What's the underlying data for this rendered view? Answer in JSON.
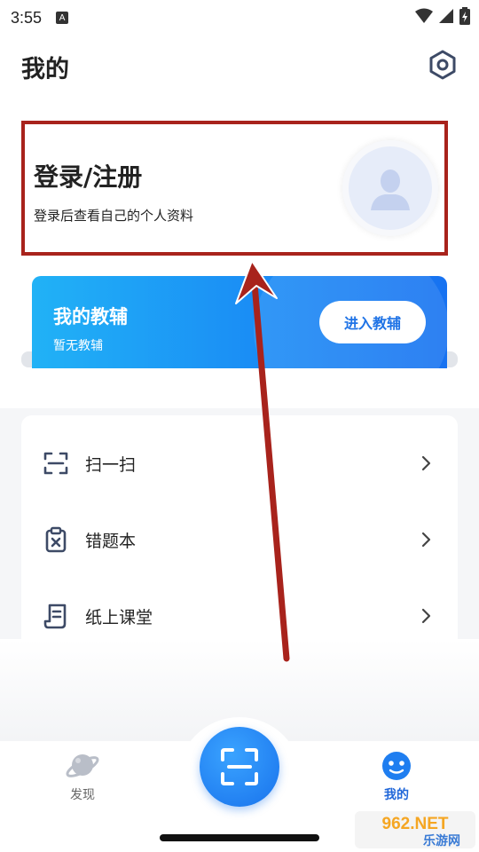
{
  "status_bar": {
    "time": "3:55",
    "notif_letter": "A"
  },
  "header": {
    "title": "我的"
  },
  "login": {
    "title": "登录/注册",
    "subtitle": "登录后查看自己的个人资料"
  },
  "tutor": {
    "title": "我的教辅",
    "subtitle": "暂无教辅",
    "button": "进入教辅"
  },
  "menu": {
    "items": [
      {
        "label": "扫一扫",
        "icon": "scan-icon"
      },
      {
        "label": "错题本",
        "icon": "clipboard-x-icon"
      },
      {
        "label": "纸上课堂",
        "icon": "document-icon"
      }
    ]
  },
  "bottom_nav": {
    "discover": "发现",
    "mine": "我的",
    "center_icon": "scan-icon"
  },
  "watermark": {
    "text_top": "962.NET",
    "text_bottom": "乐游网"
  },
  "colors": {
    "annotation_red": "#a8231c",
    "accent_blue": "#1872ec",
    "nav_inactive": "#666666"
  }
}
